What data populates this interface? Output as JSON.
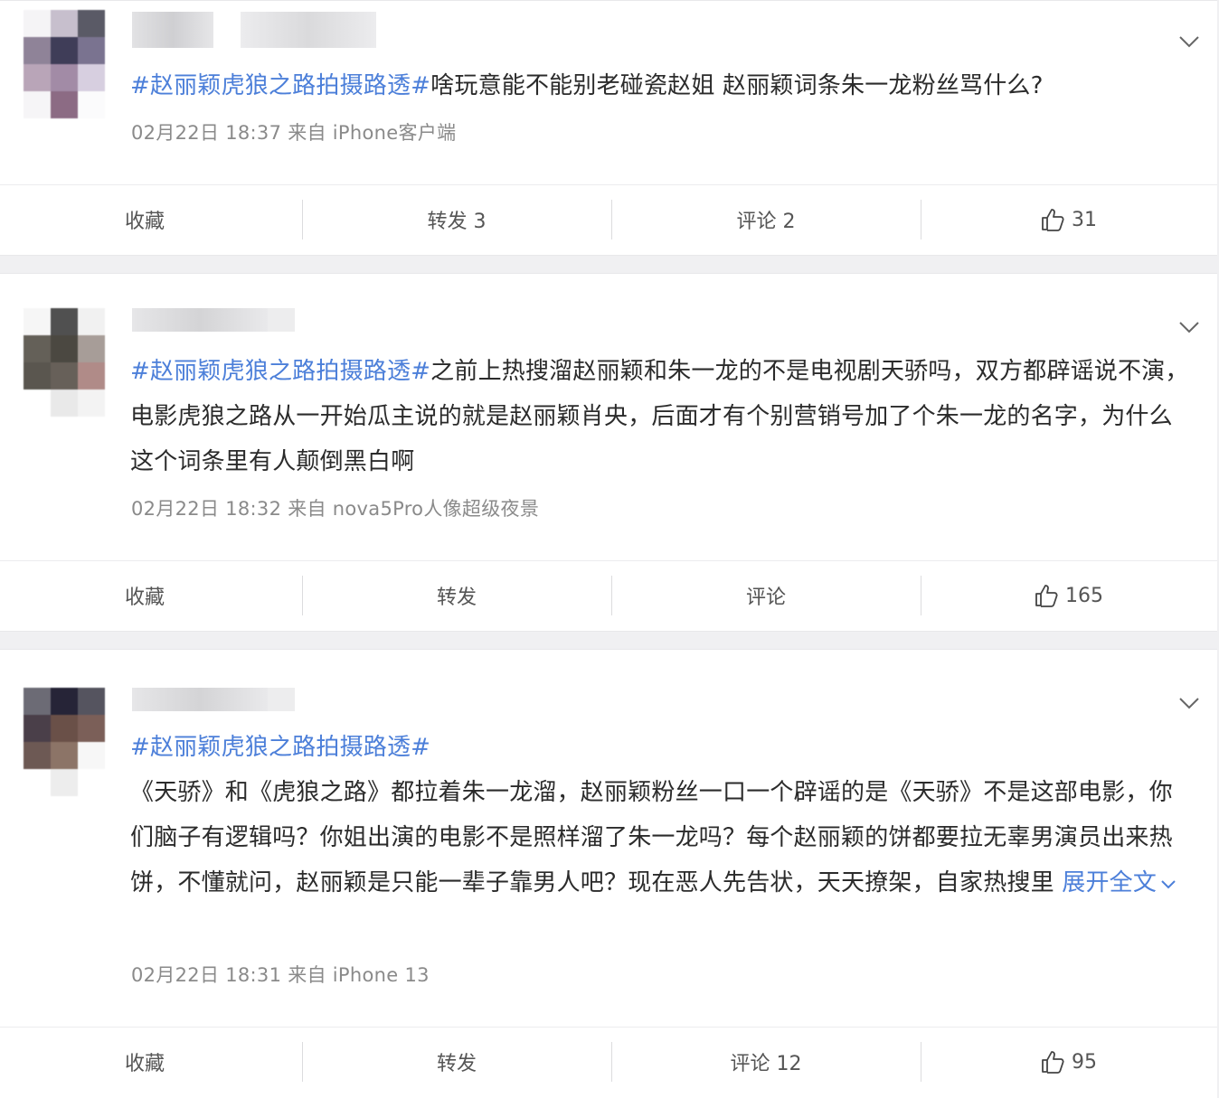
{
  "posts": [
    {
      "hashtag": "#赵丽颖虎狼之路拍摄路透#",
      "text": "啥玩意能不能别老碰瓷赵姐 赵丽颖词条朱一龙粉丝骂什么?",
      "meta": "02月22日 18:37  来自 iPhone客户端",
      "actions": {
        "favorite": "收藏",
        "forward": "转发 3",
        "comment": "评论 2",
        "likes": "31"
      }
    },
    {
      "hashtag": "#赵丽颖虎狼之路拍摄路透#",
      "text": "之前上热搜溜赵丽颖和朱一龙的不是电视剧天骄吗，双方都辟谣说不演，电影虎狼之路从一开始瓜主说的就是赵丽颖肖央，后面才有个别营销号加了个朱一龙的名字，为什么这个词条里有人颠倒黑白啊",
      "meta": "02月22日 18:32  来自 nova5Pro人像超级夜景",
      "actions": {
        "favorite": "收藏",
        "forward": "转发",
        "comment": "评论",
        "likes": "165"
      }
    },
    {
      "hashtag": "#赵丽颖虎狼之路拍摄路透#",
      "text": "《天骄》和《虎狼之路》都拉着朱一龙溜，赵丽颖粉丝一口一个辟谣的是《天骄》不是这部电影，你们脑子有逻辑吗？你姐出演的电影不是照样溜了朱一龙吗？每个赵丽颖的饼都要拉无辜男演员出来热饼，不懂就问，赵丽颖是只能一辈子靠男人吧？现在恶人先告状，天天撩架，自家热搜里",
      "expand": "展开全文",
      "meta": "02月22日 18:31  来自 iPhone 13",
      "actions": {
        "favorite": "收藏",
        "forward": "转发",
        "comment": "评论 12",
        "likes": "95"
      }
    }
  ],
  "colors": {
    "link": "#4c7fd9",
    "meta": "#8a8a8a",
    "text": "#2b2b2b"
  },
  "icons": {
    "like": "thumbs-up-icon",
    "menu": "chevron-down-icon"
  }
}
